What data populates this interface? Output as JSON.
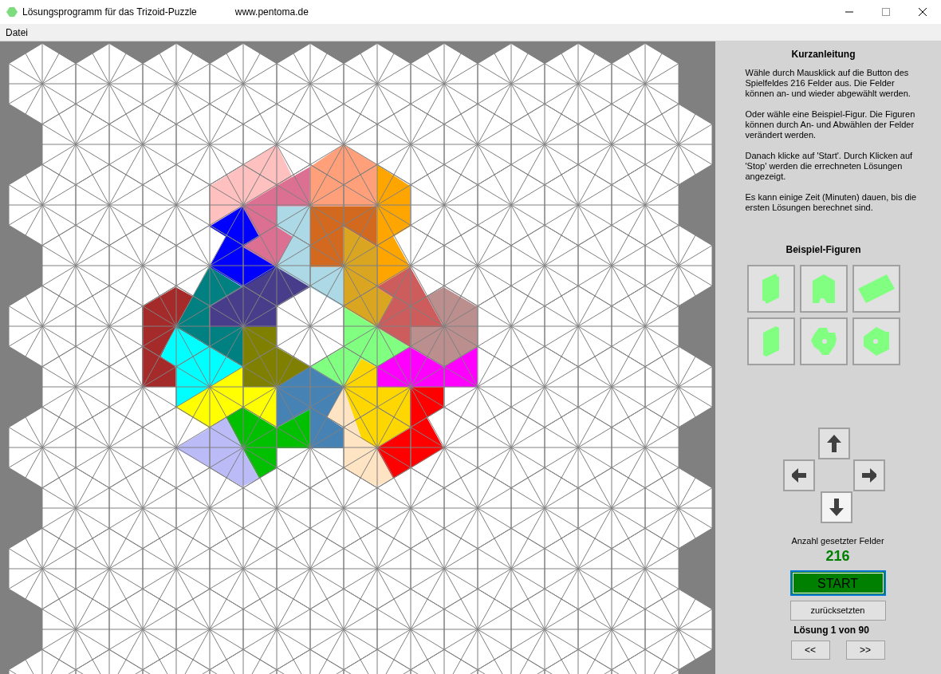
{
  "window": {
    "title": "Lösungsprogramm für das Trizoid-Puzzle",
    "url": "www.pentoma.de"
  },
  "menu": [
    "Datei"
  ],
  "sidebar": {
    "heading": "Kurzanleitung",
    "paragraphs": [
      "Wähle durch Mausklick auf die Button des Spielfeldes 216 Felder aus. Die Felder können an- und wieder abgewählt werden.",
      "Oder wähle eine Beispiel-Figur. Die Figuren können  durch An- und Abwählen der Felder verändert werden.",
      "Danach klicke auf 'Start'. Durch Klicken auf 'Stop' werden die errechneten Lösungen angezeigt.",
      "Es kann einige Zeit (Minuten) dauen, bis die ersten Lösungen berechnet sind."
    ],
    "examples_heading": "Beispiel-Figuren",
    "count_label": "Anzahl gesetzter Felder",
    "count": "216",
    "start_button": "START",
    "reset_button": "zurücksetzten",
    "solution": "Lösung 1 von 90",
    "prev_button": "<<",
    "next_button": ">>"
  }
}
